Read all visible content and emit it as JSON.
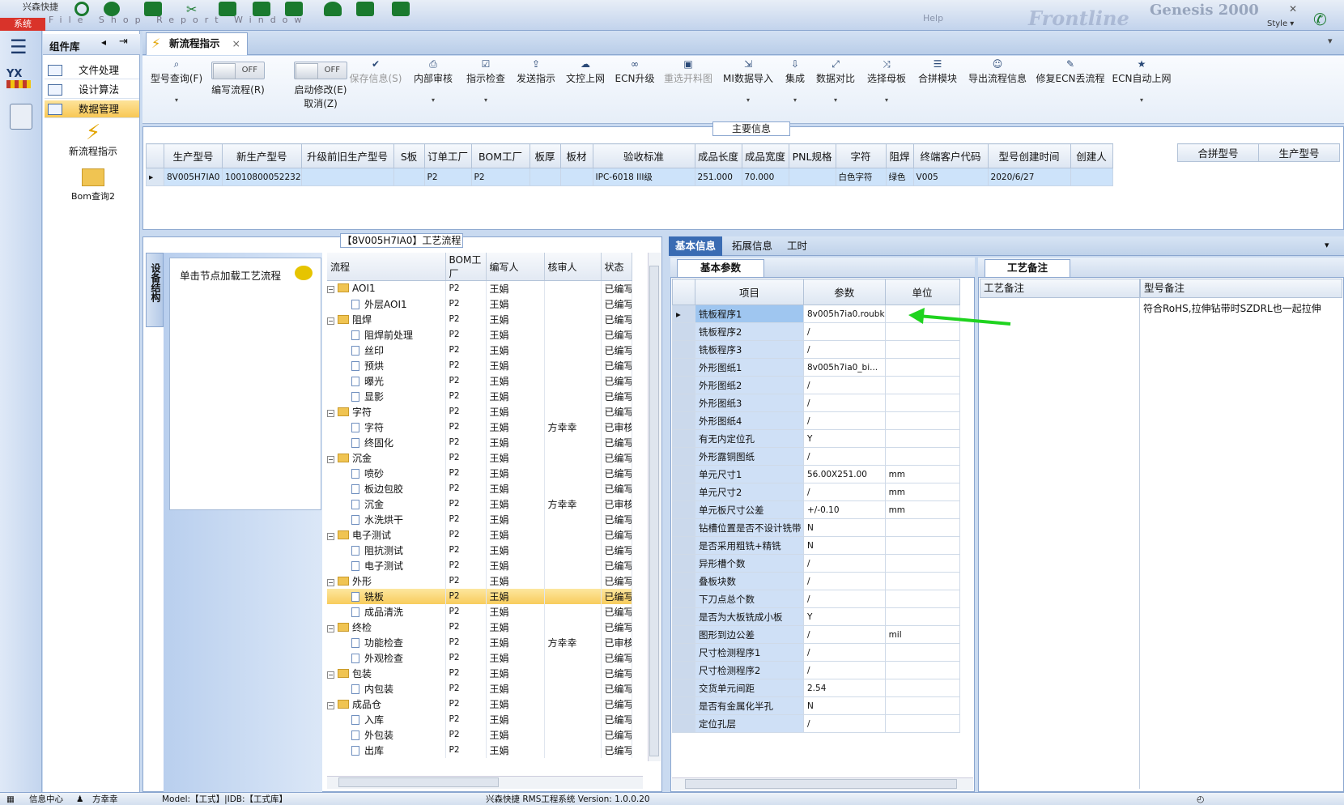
{
  "app": {
    "sys_button": "系统",
    "company": "兴森快捷",
    "menu_faint": "File  Shop  Report  Window",
    "brand": "Frontline",
    "brand2": "Genesis 2000",
    "style_label": "Style",
    "window_hint": "Help"
  },
  "rail": {
    "logo": "YX"
  },
  "component_library": {
    "title": "组件库",
    "items": [
      "文件处理",
      "设计算法",
      "数据管理"
    ],
    "active_index": 2,
    "big_icons": [
      "新流程指示",
      "Bom查询2"
    ]
  },
  "tab": {
    "label": "新流程指示",
    "close": "×"
  },
  "toolbar": [
    {
      "label": "型号查询(F)",
      "icon": "search-icon",
      "dropdown": true
    },
    {
      "label": "编写流程(R)",
      "toggle": "OFF"
    },
    {
      "label": "启动修改(E)",
      "label2": "取消(Z)",
      "toggle": "OFF"
    },
    {
      "label": "保存信息(S)",
      "icon": "check-icon",
      "disabled": true
    },
    {
      "label": "内部审核",
      "icon": "printer-icon",
      "dropdown": true
    },
    {
      "label": "指示检查",
      "icon": "checkbox-icon",
      "dropdown": true
    },
    {
      "label": "发送指示",
      "icon": "upload-icon"
    },
    {
      "label": "文控上网",
      "icon": "cloud-upload-icon"
    },
    {
      "label": "ECN升级",
      "icon": "binoculars-icon"
    },
    {
      "label": "重选开料图",
      "icon": "image-icon",
      "disabled": true
    },
    {
      "label": "MI数据导入",
      "icon": "import-icon",
      "dropdown": true
    },
    {
      "label": "集成",
      "icon": "download-icon",
      "dropdown": true
    },
    {
      "label": "数据对比",
      "icon": "compare-icon",
      "dropdown": true
    },
    {
      "label": "选择母板",
      "icon": "shuffle-icon",
      "dropdown": true
    },
    {
      "label": "合拼模块",
      "icon": "list-icon"
    },
    {
      "label": "导出流程信息",
      "icon": "smile-icon"
    },
    {
      "label": "修复ECN丢流程",
      "icon": "wrench-icon"
    },
    {
      "label": "ECN自动上网",
      "icon": "star-icon",
      "dropdown": true
    }
  ],
  "main_info": {
    "title": "主要信息",
    "columns": [
      "生产型号",
      "新生产型号",
      "升级前旧生产型号",
      "S板",
      "订单工厂",
      "BOM工厂",
      "板厚",
      "板材",
      "验收标准",
      "成品长度",
      "成品宽度",
      "PNL规格",
      "字符",
      "阻焊",
      "终端客户代码",
      "型号创建时间",
      "创建人"
    ],
    "rows": [
      [
        "8V005H7IA0",
        "10010800052232",
        "",
        "",
        "P2",
        "P2",
        "",
        "",
        "IPC-6018 III级",
        "251.000",
        "70.000",
        "",
        "白色字符",
        "绿色",
        "V005",
        "2020/6/27",
        ""
      ]
    ],
    "merge_columns": [
      "合拼型号",
      "生产型号"
    ]
  },
  "process": {
    "title": "【8V005H7IA0】工艺流程",
    "side_tab": "设备结构",
    "hint": "单击节点加载工艺流程",
    "columns": [
      "流程",
      "BOM工厂",
      "编写人",
      "核审人",
      "状态"
    ],
    "rows": [
      {
        "name": "AOI1",
        "level": 1,
        "type": "folder",
        "bom": "P2",
        "writer": "王娟",
        "reviewer": "",
        "status": "已编写"
      },
      {
        "name": "外层AOI1",
        "level": 2,
        "type": "doc",
        "bom": "P2",
        "writer": "王娟",
        "reviewer": "",
        "status": "已编写"
      },
      {
        "name": "阻焊",
        "level": 1,
        "type": "folder",
        "bom": "P2",
        "writer": "王娟",
        "reviewer": "",
        "status": "已编写"
      },
      {
        "name": "阻焊前处理",
        "level": 2,
        "type": "doc",
        "bom": "P2",
        "writer": "王娟",
        "reviewer": "",
        "status": "已编写"
      },
      {
        "name": "丝印",
        "level": 2,
        "type": "doc",
        "bom": "P2",
        "writer": "王娟",
        "reviewer": "",
        "status": "已编写"
      },
      {
        "name": "预烘",
        "level": 2,
        "type": "doc",
        "bom": "P2",
        "writer": "王娟",
        "reviewer": "",
        "status": "已编写"
      },
      {
        "name": "曝光",
        "level": 2,
        "type": "doc",
        "bom": "P2",
        "writer": "王娟",
        "reviewer": "",
        "status": "已编写"
      },
      {
        "name": "显影",
        "level": 2,
        "type": "doc",
        "bom": "P2",
        "writer": "王娟",
        "reviewer": "",
        "status": "已编写"
      },
      {
        "name": "字符",
        "level": 1,
        "type": "folder",
        "bom": "P2",
        "writer": "王娟",
        "reviewer": "",
        "status": "已编写"
      },
      {
        "name": "字符",
        "level": 2,
        "type": "doc",
        "bom": "P2",
        "writer": "王娟",
        "reviewer": "方幸幸",
        "status": "已审核"
      },
      {
        "name": "终固化",
        "level": 2,
        "type": "doc",
        "bom": "P2",
        "writer": "王娟",
        "reviewer": "",
        "status": "已编写"
      },
      {
        "name": "沉金",
        "level": 1,
        "type": "folder",
        "bom": "P2",
        "writer": "王娟",
        "reviewer": "",
        "status": "已编写"
      },
      {
        "name": "喷砂",
        "level": 2,
        "type": "doc",
        "bom": "P2",
        "writer": "王娟",
        "reviewer": "",
        "status": "已编写"
      },
      {
        "name": "板边包胶",
        "level": 2,
        "type": "doc",
        "bom": "P2",
        "writer": "王娟",
        "reviewer": "",
        "status": "已编写"
      },
      {
        "name": "沉金",
        "level": 2,
        "type": "doc",
        "bom": "P2",
        "writer": "王娟",
        "reviewer": "方幸幸",
        "status": "已审核"
      },
      {
        "name": "水洗烘干",
        "level": 2,
        "type": "doc",
        "bom": "P2",
        "writer": "王娟",
        "reviewer": "",
        "status": "已编写"
      },
      {
        "name": "电子测试",
        "level": 1,
        "type": "folder",
        "bom": "P2",
        "writer": "王娟",
        "reviewer": "",
        "status": "已编写"
      },
      {
        "name": "阻抗测试",
        "level": 2,
        "type": "doc",
        "bom": "P2",
        "writer": "王娟",
        "reviewer": "",
        "status": "已编写"
      },
      {
        "name": "电子测试",
        "level": 2,
        "type": "doc",
        "bom": "P2",
        "writer": "王娟",
        "reviewer": "",
        "status": "已编写"
      },
      {
        "name": "外形",
        "level": 1,
        "type": "folder",
        "bom": "P2",
        "writer": "王娟",
        "reviewer": "",
        "status": "已编写"
      },
      {
        "name": "铣板",
        "level": 2,
        "type": "doc",
        "bom": "P2",
        "writer": "王娟",
        "reviewer": "",
        "status": "已编写",
        "selected": true
      },
      {
        "name": "成品清洗",
        "level": 2,
        "type": "doc",
        "bom": "P2",
        "writer": "王娟",
        "reviewer": "",
        "status": "已编写"
      },
      {
        "name": "终检",
        "level": 1,
        "type": "folder",
        "bom": "P2",
        "writer": "王娟",
        "reviewer": "",
        "status": "已编写"
      },
      {
        "name": "功能检查",
        "level": 2,
        "type": "doc",
        "bom": "P2",
        "writer": "王娟",
        "reviewer": "方幸幸",
        "status": "已审核"
      },
      {
        "name": "外观检查",
        "level": 2,
        "type": "doc",
        "bom": "P2",
        "writer": "王娟",
        "reviewer": "",
        "status": "已编写"
      },
      {
        "name": "包装",
        "level": 1,
        "type": "folder",
        "bom": "P2",
        "writer": "王娟",
        "reviewer": "",
        "status": "已编写"
      },
      {
        "name": "内包装",
        "level": 2,
        "type": "doc",
        "bom": "P2",
        "writer": "王娟",
        "reviewer": "",
        "status": "已编写"
      },
      {
        "name": "成品仓",
        "level": 1,
        "type": "folder",
        "bom": "P2",
        "writer": "王娟",
        "reviewer": "",
        "status": "已编写"
      },
      {
        "name": "入库",
        "level": 2,
        "type": "doc",
        "bom": "P2",
        "writer": "王娟",
        "reviewer": "",
        "status": "已编写"
      },
      {
        "name": "外包装",
        "level": 2,
        "type": "doc",
        "bom": "P2",
        "writer": "王娟",
        "reviewer": "",
        "status": "已编写"
      },
      {
        "name": "出库",
        "level": 2,
        "type": "doc",
        "bom": "P2",
        "writer": "王娟",
        "reviewer": "",
        "status": "已编写"
      }
    ]
  },
  "right_tabs": [
    "基本信息",
    "拓展信息",
    "工时"
  ],
  "basic_params": {
    "tab": "基本参数",
    "columns": [
      "项目",
      "参数",
      "单位"
    ],
    "rows": [
      [
        "铣板程序1",
        "8v005h7ia0.roubk",
        ""
      ],
      [
        "铣板程序2",
        "/",
        ""
      ],
      [
        "铣板程序3",
        "/",
        ""
      ],
      [
        "外形图纸1",
        "8v005h7ia0_bi...",
        ""
      ],
      [
        "外形图纸2",
        "/",
        ""
      ],
      [
        "外形图纸3",
        "/",
        ""
      ],
      [
        "外形图纸4",
        "/",
        ""
      ],
      [
        "有无内定位孔",
        "Y",
        ""
      ],
      [
        "外形露铜图纸",
        "/",
        ""
      ],
      [
        "单元尺寸1",
        "56.00X251.00",
        "mm"
      ],
      [
        "单元尺寸2",
        "/",
        "mm"
      ],
      [
        "单元板尺寸公差",
        "+/-0.10",
        "mm"
      ],
      [
        "钻槽位置是否不设计铣带",
        "N",
        ""
      ],
      [
        "是否采用粗铣+精铣",
        "N",
        ""
      ],
      [
        "异形槽个数",
        "/",
        ""
      ],
      [
        "叠板块数",
        "/",
        ""
      ],
      [
        "下刀点总个数",
        "/",
        ""
      ],
      [
        "是否为大板铣成小板",
        "Y",
        ""
      ],
      [
        "图形到边公差",
        "/",
        "mil"
      ],
      [
        "尺寸检测程序1",
        "/",
        ""
      ],
      [
        "尺寸检测程序2",
        "/",
        ""
      ],
      [
        "交货单元间距",
        "2.54",
        ""
      ],
      [
        "是否有金属化半孔",
        "N",
        ""
      ],
      [
        "定位孔层",
        "/",
        ""
      ]
    ]
  },
  "process_notes": {
    "tab": "工艺备注",
    "col1": "工艺备注",
    "col2": "型号备注",
    "model_note": "符合RoHS,拉伸钻带时SZDRL也一起拉伸"
  },
  "status_bar": {
    "info_center": "信息中心",
    "user": "方幸幸",
    "model": "Model:【工式】|IDB:【工式库】",
    "system": "兴森快捷 RMS工程系统 Version: 1.0.0.20"
  },
  "colors": {
    "accent": "#3a6cb3",
    "selection": "#f8cc5c",
    "row_highlight": "#cde3fa",
    "annotation_arrow": "#1fd31f"
  }
}
